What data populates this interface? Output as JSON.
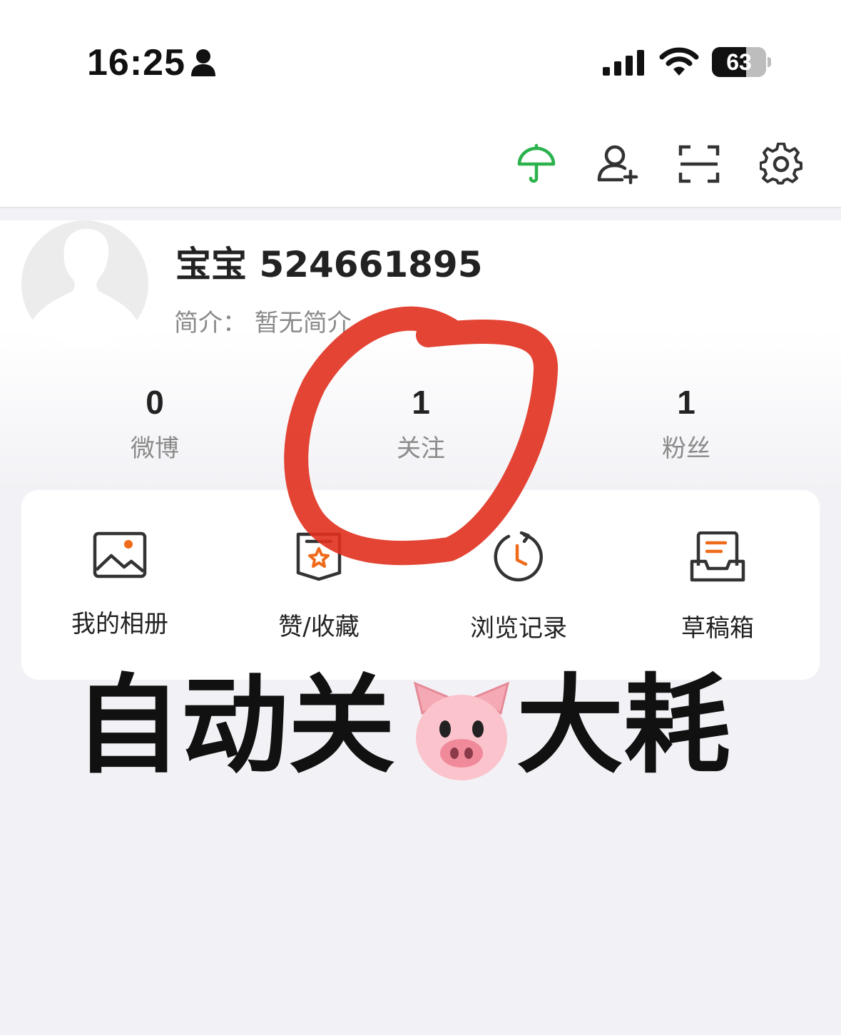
{
  "status_bar": {
    "time": "16:25",
    "battery_percent": "63",
    "battery_level": 0.63
  },
  "header": {
    "icons": [
      "umbrella-icon",
      "add-friend-icon",
      "scan-icon",
      "settings-icon"
    ],
    "accent_color": "#2bb24c"
  },
  "profile": {
    "username": "宝宝 524661895",
    "bio": "简介：  暂无简介"
  },
  "stats": [
    {
      "value": "0",
      "label": "微博"
    },
    {
      "value": "1",
      "label": "关注"
    },
    {
      "value": "1",
      "label": "粉丝"
    }
  ],
  "menu": [
    {
      "label": "我的相册",
      "icon": "photo-album-icon"
    },
    {
      "label": "赞/收藏",
      "icon": "favorites-icon"
    },
    {
      "label": "浏览记录",
      "icon": "history-icon"
    },
    {
      "label": "草稿箱",
      "icon": "drafts-icon"
    }
  ],
  "overlay": {
    "text_before": "自动关",
    "emoji": "pig-face",
    "text_after": "大耗",
    "annotation_color": "#e0301e"
  },
  "colors": {
    "icon_orange": "#ef6b1b",
    "text_primary": "#222222",
    "text_secondary": "#8a8a8a"
  }
}
